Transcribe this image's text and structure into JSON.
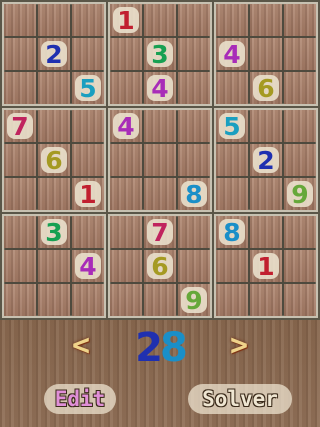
{
  "colors": {
    "1": "#c11f2f",
    "2": "#1f30b0",
    "3": "#17a052",
    "4": "#a82cb8",
    "5": "#1a9fc0",
    "6": "#a59a22",
    "7": "#c0245e",
    "8": "#1a8fc8",
    "9": "#66a83a"
  },
  "board": {
    "cells": [
      [
        0,
        0,
        0,
        1,
        0,
        0,
        0,
        0,
        0
      ],
      [
        0,
        2,
        0,
        0,
        3,
        0,
        4,
        0,
        0
      ],
      [
        0,
        0,
        5,
        0,
        4,
        0,
        0,
        6,
        0
      ],
      [
        7,
        0,
        0,
        4,
        0,
        0,
        5,
        0,
        0
      ],
      [
        0,
        6,
        0,
        0,
        0,
        0,
        0,
        2,
        0
      ],
      [
        0,
        0,
        1,
        0,
        0,
        8,
        0,
        0,
        9
      ],
      [
        0,
        3,
        0,
        0,
        7,
        0,
        8,
        0,
        0
      ],
      [
        0,
        0,
        4,
        0,
        6,
        0,
        0,
        1,
        0
      ],
      [
        0,
        0,
        0,
        0,
        0,
        9,
        0,
        0,
        0
      ]
    ]
  },
  "controls": {
    "prev_label": "<",
    "next_label": ">",
    "puzzle_number_a": "2",
    "puzzle_number_b": "8",
    "edit_label": "Edit",
    "solver_label": "Solver"
  }
}
